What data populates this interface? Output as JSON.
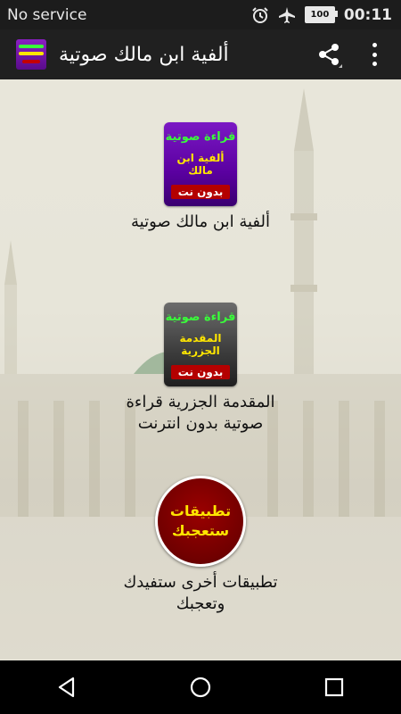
{
  "status_bar": {
    "carrier": "No service",
    "battery": "100",
    "time": "00:11"
  },
  "app_bar": {
    "title": "ألفية ابن مالك صوتية"
  },
  "items": [
    {
      "tile_line1": "قراءة صوتية",
      "tile_line2": "ألفية ابن مالك",
      "tile_badge": "بدون نت",
      "label": "ألفية ابن مالك صوتية"
    },
    {
      "tile_line1": "قراءة صوتية",
      "tile_line2": "المقدمة الجزرية",
      "tile_badge": "بدون نت",
      "label_line1": "المقدمة الجزرية قراءة",
      "label_line2": "صوتية بدون انترنت"
    },
    {
      "circle_line1": "تطبيقات",
      "circle_line2": "ستعجبك",
      "label_line1": "تطبيقات أخرى ستفيدك",
      "label_line2": "وتعجبك"
    }
  ],
  "icons": {
    "alarm": "alarm-icon",
    "airplane": "airplane-icon",
    "battery": "battery-icon",
    "share": "share-icon",
    "overflow": "more-vert-icon",
    "back": "back-icon",
    "home": "home-icon",
    "recents": "recents-icon"
  },
  "colors": {
    "app_bar": "#202020",
    "status_bar": "#1c1c1c",
    "tile_purple": "#6a0db0",
    "tile_gray": "#3f3f3f",
    "badge_red": "#b40000",
    "circle_red": "#800000"
  }
}
